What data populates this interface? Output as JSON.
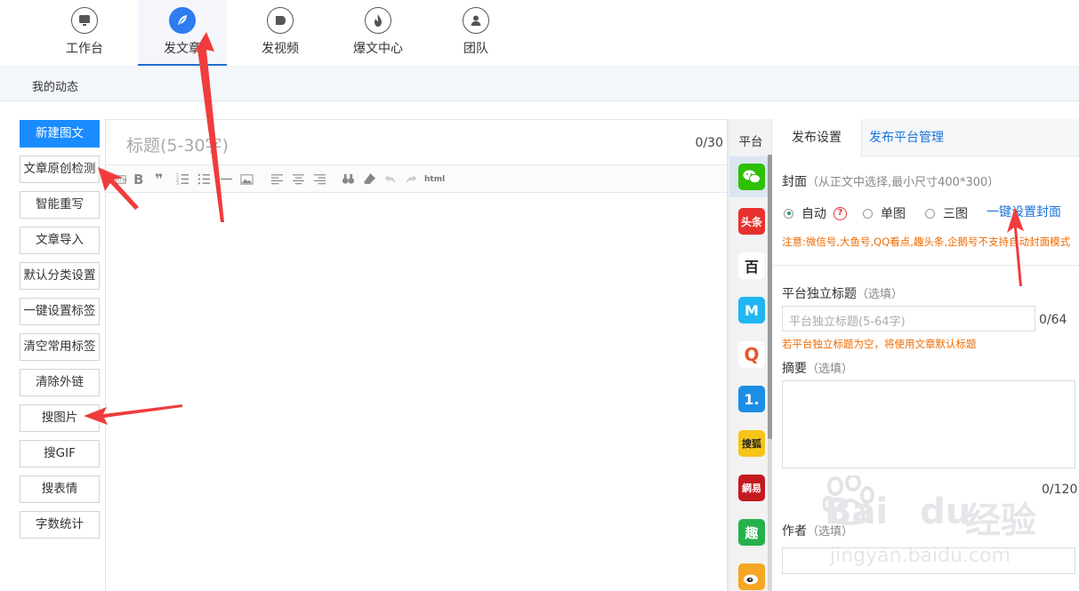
{
  "nav": {
    "items": [
      {
        "label": "工作台",
        "icon": "monitor-icon"
      },
      {
        "label": "发文章",
        "icon": "feather-icon",
        "active": true
      },
      {
        "label": "发视频",
        "icon": "play-icon"
      },
      {
        "label": "爆文中心",
        "icon": "fire-icon"
      },
      {
        "label": "团队",
        "icon": "user-icon"
      }
    ],
    "accent": "#2d7cf0"
  },
  "subbar": {
    "link": "我的动态"
  },
  "tools": [
    {
      "label": "新建图文",
      "primary": true
    },
    {
      "label": "文章原创检测"
    },
    {
      "label": "智能重写"
    },
    {
      "label": "文章导入"
    },
    {
      "label": "默认分类设置"
    },
    {
      "label": "一键设置标签"
    },
    {
      "label": "清空常用标签"
    },
    {
      "label": "清除外链"
    },
    {
      "label": "搜图片"
    },
    {
      "label": "搜GIF"
    },
    {
      "label": "搜表情"
    },
    {
      "label": "字数统计"
    }
  ],
  "editor": {
    "title_placeholder": "标题(5-30字)",
    "title_count": "0/30",
    "toolbar_html_label": "html"
  },
  "platforms": {
    "title": "平台",
    "items": [
      {
        "name": "wechat-icon",
        "label": "",
        "color": "#2dc100"
      },
      {
        "name": "toutiao-icon",
        "label": "头条",
        "color": "#e8322e"
      },
      {
        "name": "baijiahao-icon",
        "label": "百",
        "color": "#ffffff"
      },
      {
        "name": "dayu-icon",
        "label": "M",
        "color": "#1fb6f2"
      },
      {
        "name": "qq-kandian-icon",
        "label": "Q",
        "color": "#ffffff"
      },
      {
        "name": "yidian-icon",
        "label": "1.",
        "color": "#1c8ee6"
      },
      {
        "name": "sohu-icon",
        "label": "搜狐",
        "color": "#f5c518"
      },
      {
        "name": "netease-icon",
        "label": "網易",
        "color": "#c41a20"
      },
      {
        "name": "qutoutiao-icon",
        "label": "趣",
        "color": "#26b14c"
      },
      {
        "name": "weibo-icon",
        "label": "",
        "color": "#f5a623"
      }
    ]
  },
  "settings": {
    "tab_active": "发布设置",
    "tab_link": "发布平台管理",
    "cover_label": "封面",
    "cover_hint": "（从正文中选择,最小尺寸400*300）",
    "radio_auto": "自动",
    "radio_single": "单图",
    "radio_triple": "三图",
    "one_click_cover": "一键设置封面",
    "cover_note": "注意:微信号,大鱼号,QQ看点,趣头条,企鹅号不支持自动封面模式",
    "title_label": "平台独立标题",
    "title_hint": "（选填）",
    "title_placeholder": "平台独立标题(5-64字)",
    "title_count": "0/64",
    "title_note": "若平台独立标题为空，将使用文章默认标题",
    "summary_label": "摘要",
    "summary_hint": "（选填）",
    "summary_count": "0/120",
    "author_label": "作者",
    "author_hint": "（选填）"
  },
  "watermark": {
    "brand": "Bai",
    "brand2": "du",
    "cn": "经验",
    "url": "jingyan.baidu.com"
  }
}
